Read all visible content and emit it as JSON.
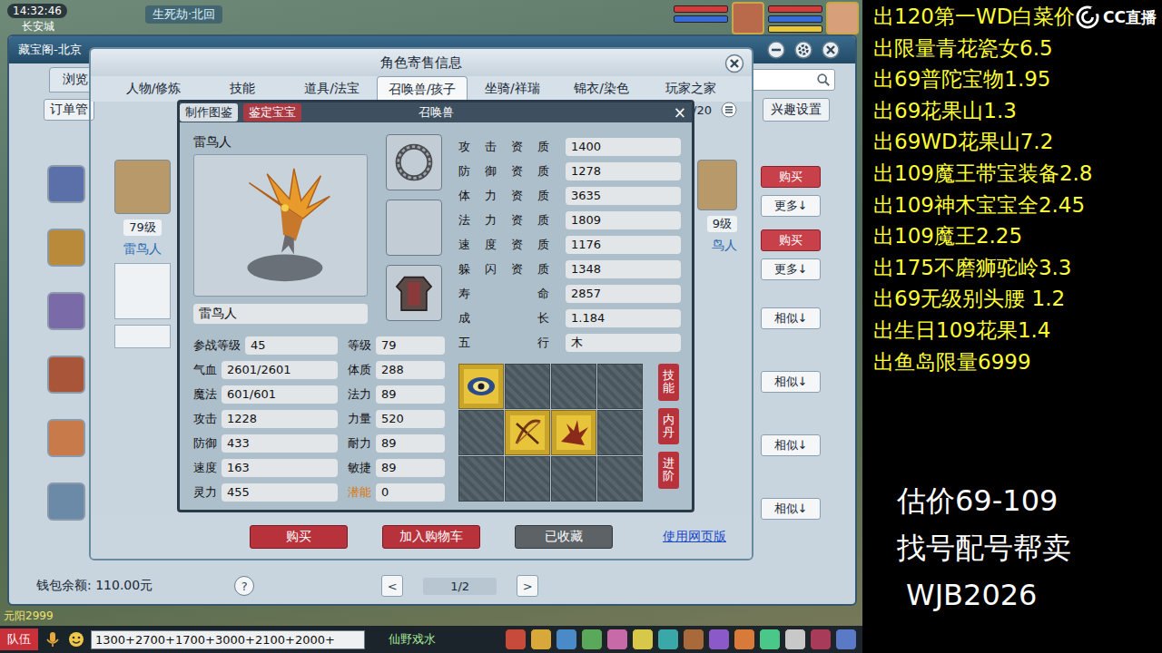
{
  "hud": {
    "time": "14:32:46",
    "city": "长安城",
    "quest": "生死劫·北回"
  },
  "market": {
    "title": "藏宝阁-北京",
    "nav_tab": "浏览",
    "order_field": "订单管",
    "count": "/20",
    "interest_button": "兴趣设置",
    "left_card": {
      "level": "79级",
      "name": "雷鸟人"
    },
    "right_card": {
      "level": "9级",
      "name": "鸟人"
    },
    "rows": [
      {
        "actions": [
          {
            "label": "购买",
            "kind": "buy"
          },
          {
            "label": "更多↓",
            "kind": "more"
          }
        ]
      },
      {
        "actions": [
          {
            "label": "购买",
            "kind": "buy"
          },
          {
            "label": "更多↓",
            "kind": "more"
          }
        ]
      },
      {
        "actions": [
          {
            "label": "相似↓",
            "kind": "more"
          }
        ]
      },
      {
        "actions": [
          {
            "label": "相似↓",
            "kind": "more"
          }
        ]
      },
      {
        "actions": [
          {
            "label": "相似↓",
            "kind": "more"
          }
        ]
      },
      {
        "actions": [
          {
            "label": "相似↓",
            "kind": "more"
          }
        ]
      }
    ],
    "wallet": "钱包余额: 110.00元",
    "help": "?",
    "pager": {
      "prev": "<",
      "page": "1/2",
      "next": ">"
    }
  },
  "sale_window": {
    "title": "角色寄售信息",
    "tabs": [
      {
        "label": "人物/修炼",
        "selected": false
      },
      {
        "label": "技能",
        "selected": false
      },
      {
        "label": "道具/法宝",
        "selected": false
      },
      {
        "label": "召唤兽/孩子",
        "selected": true
      },
      {
        "label": "坐骑/祥瑞",
        "selected": false
      },
      {
        "label": "锦衣/染色",
        "selected": false
      },
      {
        "label": "玩家之家",
        "selected": false
      }
    ],
    "actions": [
      {
        "label": "购买",
        "kind": "red"
      },
      {
        "label": "加入购物车",
        "kind": "red"
      },
      {
        "label": "已收藏",
        "kind": "gray"
      },
      {
        "label": "使用网页版",
        "kind": "link"
      }
    ]
  },
  "pet_window": {
    "title": "召唤兽",
    "close": "×",
    "tools": [
      {
        "label": "制作图鉴",
        "selected": false
      },
      {
        "label": "鉴定宝宝",
        "selected": true
      }
    ],
    "pet": {
      "name": "雷鸟人",
      "name_field": "雷鸟人"
    },
    "equipment": [
      {
        "kind": "ring"
      },
      {
        "kind": "empty"
      },
      {
        "kind": "armor"
      }
    ],
    "stats": [
      {
        "left": {
          "label": "参战等级",
          "value": "45",
          "highlight": false
        },
        "right": {
          "label": "等级",
          "value": "79",
          "highlight": false
        }
      },
      {
        "left": {
          "label": "气血",
          "value": "2601/2601",
          "highlight": false
        },
        "right": {
          "label": "体质",
          "value": "288",
          "highlight": false
        }
      },
      {
        "left": {
          "label": "魔法",
          "value": "601/601",
          "highlight": false
        },
        "right": {
          "label": "法力",
          "value": "89",
          "highlight": false
        }
      },
      {
        "left": {
          "label": "攻击",
          "value": "1228",
          "highlight": false
        },
        "right": {
          "label": "力量",
          "value": "520",
          "highlight": false
        }
      },
      {
        "left": {
          "label": "防御",
          "value": "433",
          "highlight": false
        },
        "right": {
          "label": "耐力",
          "value": "89",
          "highlight": false
        }
      },
      {
        "left": {
          "label": "速度",
          "value": "163",
          "highlight": false
        },
        "right": {
          "label": "敏捷",
          "value": "89",
          "highlight": false
        }
      },
      {
        "left": {
          "label": "灵力",
          "value": "455",
          "highlight": false
        },
        "right": {
          "label": "潜能",
          "value": "0",
          "highlight": true
        }
      }
    ],
    "aptitudes": [
      {
        "label": "攻击资质",
        "value": "1400",
        "highlight": false
      },
      {
        "label": "防御资质",
        "value": "1278",
        "highlight": false
      },
      {
        "label": "体力资质",
        "value": "3635",
        "highlight": false
      },
      {
        "label": "法力资质",
        "value": "1809",
        "highlight": false
      },
      {
        "label": "速度资质",
        "value": "1176",
        "highlight": false
      },
      {
        "label": "躲闪资质",
        "value": "1348",
        "highlight": false
      },
      {
        "label": "寿命",
        "value": "2857",
        "highlight": true
      },
      {
        "label": "成长",
        "value": "1.184",
        "highlight": true
      },
      {
        "label": "五行",
        "value": "木",
        "highlight": true
      }
    ],
    "skills": [
      {
        "kind": "eye"
      },
      {
        "kind": "empty"
      },
      {
        "kind": "empty"
      },
      {
        "kind": "empty"
      },
      {
        "kind": "empty"
      },
      {
        "kind": "bow"
      },
      {
        "kind": "claw"
      },
      {
        "kind": "empty"
      },
      {
        "kind": "empty"
      },
      {
        "kind": "empty"
      },
      {
        "kind": "empty"
      },
      {
        "kind": "empty"
      }
    ],
    "side_buttons": [
      "技能",
      "内丹",
      "进阶"
    ]
  },
  "chat": {
    "team": "队伍",
    "input": "1300+2700+1700+3000+2100+2000+",
    "channel_text": "仙野戏水",
    "corner_text": "元阳2999"
  },
  "stream": {
    "logo": "CC直播",
    "listings": [
      "出120第一WD白菜价",
      "出限量青花瓷女6.5",
      "出69普陀宝物1.95",
      "出69花果山1.3",
      "出69WD花果山7.2",
      "出109魔王带宝装备2.8",
      "出109神木宝宝全2.45",
      "出109魔王2.25",
      "出175不磨狮驼岭3.3",
      "出69无级别头腰 1.2",
      "出生日109花果1.4",
      "出鱼岛限量6999"
    ],
    "estimate": "估价69-109",
    "service": "找号配号帮卖",
    "contact": "WJB2026"
  }
}
